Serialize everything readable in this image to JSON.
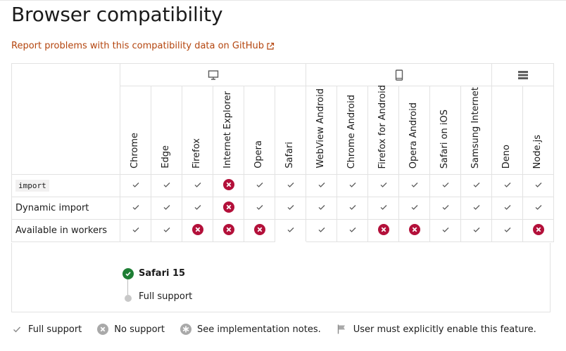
{
  "page": {
    "title": "Browser compatibility",
    "report_link": "Report problems with this compatibility data on GitHub"
  },
  "platforms": [
    {
      "name": "desktop",
      "icon": "desktop-icon"
    },
    {
      "name": "mobile",
      "icon": "mobile-icon"
    },
    {
      "name": "server",
      "icon": "server-icon"
    }
  ],
  "browsers": [
    "Chrome",
    "Edge",
    "Firefox",
    "Internet Explorer",
    "Opera",
    "Safari",
    "WebView Android",
    "Chrome Android",
    "Firefox for Android",
    "Opera Android",
    "Safari on iOS",
    "Samsung Internet",
    "Deno",
    "Node.js"
  ],
  "features": [
    {
      "name": "import",
      "code": true,
      "support": [
        "yes",
        "yes",
        "yes",
        "no",
        "yes",
        "yes",
        "yes",
        "yes",
        "yes",
        "yes",
        "yes",
        "yes",
        "yes",
        "yes"
      ]
    },
    {
      "name": "Dynamic import",
      "code": false,
      "support": [
        "yes",
        "yes",
        "yes",
        "no",
        "yes",
        "yes",
        "yes",
        "yes",
        "yes",
        "yes",
        "yes",
        "yes",
        "yes",
        "yes"
      ]
    },
    {
      "name": "Available in workers",
      "code": false,
      "support": [
        "yes",
        "yes",
        "no",
        "no",
        "no",
        "yes",
        "yes",
        "yes",
        "no",
        "no",
        "yes",
        "yes",
        "yes",
        "no"
      ]
    }
  ],
  "detail": {
    "version": "Safari 15",
    "fallback": "Full support"
  },
  "legend": {
    "full": "Full support",
    "no": "No support",
    "notes": "See implementation notes.",
    "flag": "User must explicitly enable this feature."
  },
  "colors": {
    "accent_link": "#b4450e",
    "no_support": "#b3103a",
    "yes_check": "#5c5c5c",
    "ok_dot": "#1e7e34"
  }
}
